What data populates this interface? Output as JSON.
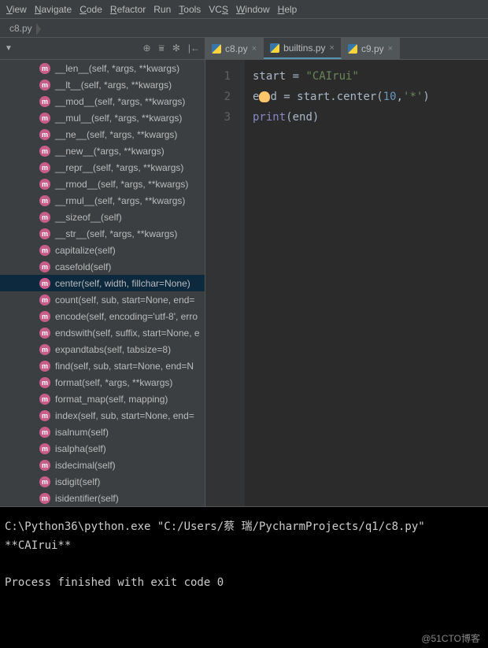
{
  "menubar": [
    {
      "label": "View",
      "accel": "V"
    },
    {
      "label": "Navigate",
      "accel": "N"
    },
    {
      "label": "Code",
      "accel": "C"
    },
    {
      "label": "Refactor",
      "accel": "R"
    },
    {
      "label": "Run",
      "accel": null
    },
    {
      "label": "Tools",
      "accel": "T"
    },
    {
      "label": "VCS",
      "accel": "S"
    },
    {
      "label": "Window",
      "accel": "W"
    },
    {
      "label": "Help",
      "accel": "H"
    }
  ],
  "breadcrumb": "c8.py",
  "members": [
    "__len__(self, *args, **kwargs)",
    "__lt__(self, *args, **kwargs)",
    "__mod__(self, *args, **kwargs)",
    "__mul__(self, *args, **kwargs)",
    "__ne__(self, *args, **kwargs)",
    "__new__(*args, **kwargs)",
    "__repr__(self, *args, **kwargs)",
    "__rmod__(self, *args, **kwargs)",
    "__rmul__(self, *args, **kwargs)",
    "__sizeof__(self)",
    "__str__(self, *args, **kwargs)",
    "capitalize(self)",
    "casefold(self)",
    "center(self, width, fillchar=None)",
    "count(self, sub, start=None, end=",
    "encode(self, encoding='utf-8', erro",
    "endswith(self, suffix, start=None, e",
    "expandtabs(self, tabsize=8)",
    "find(self, sub, start=None, end=N",
    "format(self, *args, **kwargs)",
    "format_map(self, mapping)",
    "index(self, sub, start=None, end=",
    "isalnum(self)",
    "isalpha(self)",
    "isdecimal(self)",
    "isdigit(self)",
    "isidentifier(self)"
  ],
  "selected_member_index": 13,
  "tabs": [
    {
      "label": "c8.py",
      "active": false
    },
    {
      "label": "builtins.py",
      "active": true
    },
    {
      "label": "c9.py",
      "active": false
    }
  ],
  "gutter": [
    "1",
    "2",
    "3"
  ],
  "code": {
    "l1": {
      "a": "start = ",
      "b": "\"CAIrui\""
    },
    "l2": {
      "a": "end = start.center(",
      "b": "10",
      "c": ",",
      "d": "'*'",
      "e": ")"
    },
    "l3": {
      "a": "print",
      "b": "(end)"
    }
  },
  "console": {
    "cmd": "C:\\Python36\\python.exe \"C:/Users/蔡 瑞/PycharmProjects/q1/c8.py\"",
    "out": "**CAIrui**",
    "exit": "Process finished with exit code 0"
  },
  "watermark": "@51CTO博客"
}
